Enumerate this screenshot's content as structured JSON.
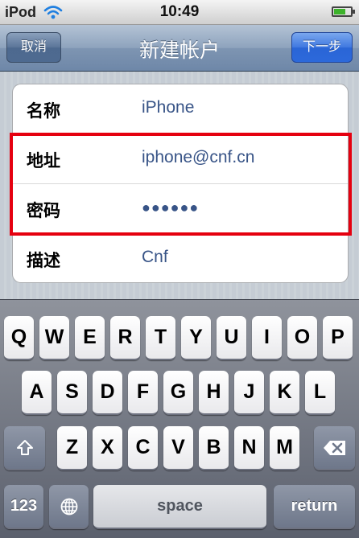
{
  "status_bar": {
    "carrier": "iPod",
    "time": "10:49"
  },
  "nav": {
    "title": "新建帐户",
    "cancel_label": "取消",
    "next_label": "下一步"
  },
  "form": {
    "rows": [
      {
        "label": "名称",
        "value": "iPhone"
      },
      {
        "label": "地址",
        "value": "iphone@cnf.cn"
      },
      {
        "label": "密码",
        "value": "●●●●●●"
      },
      {
        "label": "描述",
        "value": "Cnf"
      }
    ]
  },
  "keyboard": {
    "row1": [
      "Q",
      "W",
      "E",
      "R",
      "T",
      "Y",
      "U",
      "I",
      "O",
      "P"
    ],
    "row2": [
      "A",
      "S",
      "D",
      "F",
      "G",
      "H",
      "J",
      "K",
      "L"
    ],
    "row3": [
      "Z",
      "X",
      "C",
      "V",
      "B",
      "N",
      "M"
    ],
    "numbers_label": "123",
    "space_label": "space",
    "return_label": "return"
  },
  "colors": {
    "highlight": "#e5000f",
    "value_text": "#385487",
    "next_button": "#2c69db"
  }
}
